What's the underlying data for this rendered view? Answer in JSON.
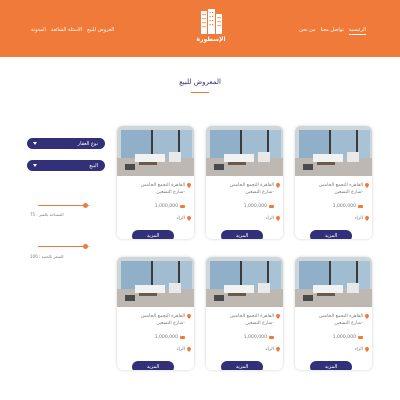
{
  "nav": {
    "right_items": [
      "الرئيسية",
      "تواصل معنا",
      "من نحن"
    ],
    "left_items": [
      "العروض للبيع",
      "الاسئلة الشائعة",
      "المدونة"
    ]
  },
  "logo": {
    "text": "الإسطورة"
  },
  "page_title": "المعروض للبيع",
  "filters": {
    "property_type": "نوع العقار",
    "sale": "البيع",
    "area_label": "المساحة بالمتر : 75",
    "rooms_label": "السعر بالجنيه : 100",
    "area_level_percent": 92,
    "rooms_level_percent": 92
  },
  "cards": [
    {
      "address_line1": "القاهرة التجمع الخامس",
      "address_line2": "-شارع التسعين",
      "price": "1,000,000",
      "type": "الزاد",
      "button": "المزيد"
    },
    {
      "address_line1": "القاهرة التجمع الخامس",
      "address_line2": "-شارع التسعين",
      "price": "1,000,000",
      "type": "الزاد",
      "button": "المزيد"
    },
    {
      "address_line1": "القاهرة التجمع الخامس",
      "address_line2": "-شارع التسعين",
      "price": "1,000,000",
      "type": "الزاد",
      "button": "المزيد"
    },
    {
      "address_line1": "القاهرة التجمع الخامس",
      "address_line2": "-شارع التسعين",
      "price": "1,000,000",
      "type": "الزاد",
      "button": "المزيد"
    },
    {
      "address_line1": "القاهرة التجمع الخامس",
      "address_line2": "-شارع التسعين",
      "price": "1,000,000",
      "type": "الزاد",
      "button": "المزيد"
    },
    {
      "address_line1": "القاهرة التجمع الخامس",
      "address_line2": "-شارع التسعين",
      "price": "1,000,000",
      "type": "الزاد",
      "button": "المزيد"
    }
  ],
  "colors": {
    "accent": "#f07a3a",
    "primary": "#33307a"
  },
  "icons": [
    "logo-building-icon",
    "map-pin-icon",
    "price-tag-icon",
    "dropdown-caret-icon"
  ]
}
